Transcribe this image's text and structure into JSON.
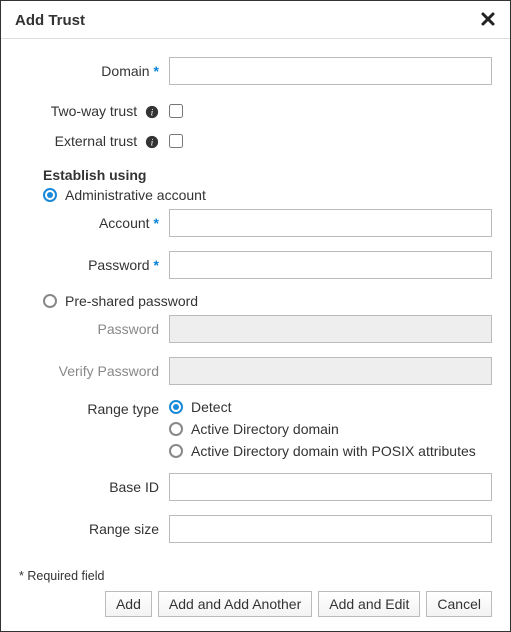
{
  "dialog": {
    "title": "Add Trust",
    "close_label": "Close"
  },
  "fields": {
    "domain_label": "Domain",
    "domain_value": "",
    "two_way_label": "Two-way trust",
    "two_way_checked": false,
    "external_label": "External trust",
    "external_checked": false
  },
  "establish": {
    "heading": "Establish using",
    "admin_option": "Administrative account",
    "preshared_option": "Pre-shared password",
    "selected": "admin",
    "account_label": "Account",
    "account_value": "",
    "admin_password_label": "Password",
    "admin_password_value": "",
    "preshared_password_label": "Password",
    "preshared_password_value": "",
    "verify_password_label": "Verify Password",
    "verify_password_value": ""
  },
  "range": {
    "type_label": "Range type",
    "options": {
      "detect": "Detect",
      "ad": "Active Directory domain",
      "adposix": "Active Directory domain with POSIX attributes"
    },
    "selected": "detect",
    "base_id_label": "Base ID",
    "base_id_value": "",
    "range_size_label": "Range size",
    "range_size_value": ""
  },
  "footer": {
    "required_note": "* Required field",
    "add": "Add",
    "add_another": "Add and Add Another",
    "add_edit": "Add and Edit",
    "cancel": "Cancel"
  }
}
